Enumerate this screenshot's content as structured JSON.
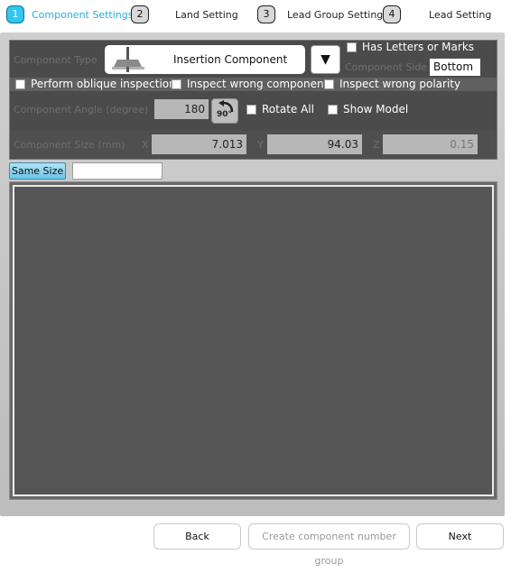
{
  "steps": [
    {
      "num": "1",
      "label": "Component Settings"
    },
    {
      "num": "2",
      "label": "Land Setting"
    },
    {
      "num": "3",
      "label": "Lead Group Setting"
    },
    {
      "num": "4",
      "label": "Lead Setting"
    }
  ],
  "component": {
    "type_label": "Component Type",
    "type_value": "Insertion Component",
    "dropdown_glyph": "▼",
    "has_letters_label": "Has Letters or Marks",
    "side_label": "Component Side",
    "side_value": "Bottom"
  },
  "options": {
    "oblique": "Perform oblique inspection",
    "wrong_component": "Inspect wrong component",
    "wrong_polarity": "Inspect wrong polarity"
  },
  "angle": {
    "label": "Component Angle (degree)",
    "value": "180",
    "rotate_icon_text": "90°",
    "rotate_all_label": "Rotate All",
    "show_model_label": "Show Model"
  },
  "size": {
    "label": "Component Size (mm)",
    "x_label": "X",
    "x_value": "7.013",
    "y_label": "Y",
    "y_value": "94.03",
    "z_label": "Z",
    "z_value": "0.15"
  },
  "same_size": {
    "button_label": "Same Size",
    "input_value": ""
  },
  "footer": {
    "back": "Back",
    "create_group": "Create component number group",
    "next": "Next"
  },
  "colors": {
    "accent": "#2ec8f0",
    "panel": "#4b4b4b",
    "view": "#555555"
  }
}
